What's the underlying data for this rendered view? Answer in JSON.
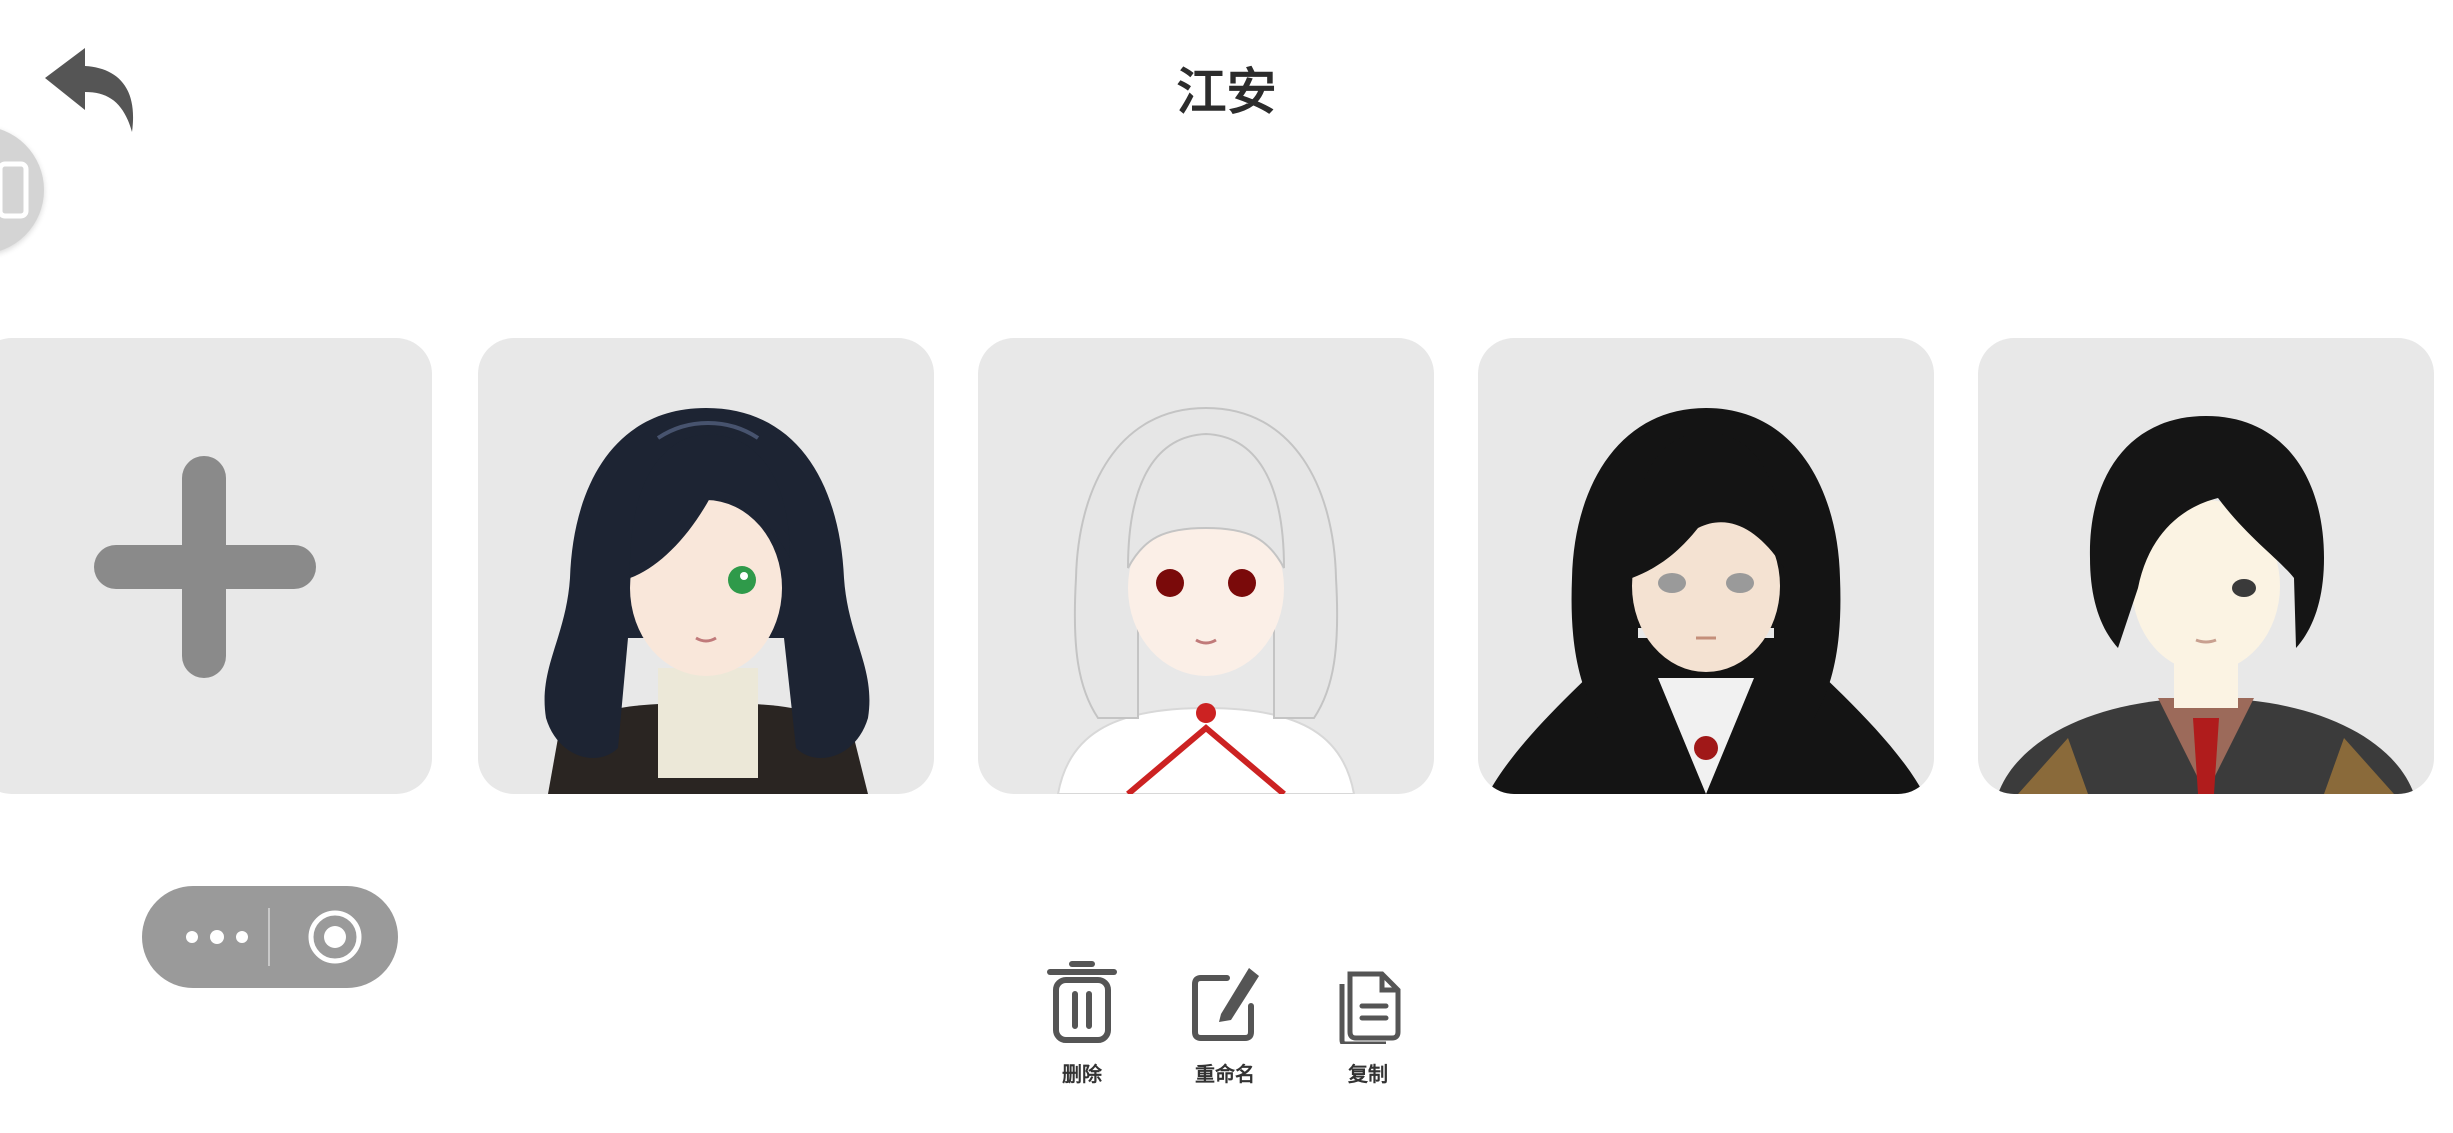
{
  "header": {
    "title": "江安",
    "back_icon": "back-arrow-icon"
  },
  "side_handle": {
    "icon": "phone-icon"
  },
  "cards": [
    {
      "type": "add",
      "icon": "plus-icon"
    },
    {
      "type": "avatar",
      "hair": "#1d2433",
      "skin": "#f9e7da",
      "eyes": "#2f9a4a",
      "outfit": "#2a2522"
    },
    {
      "type": "avatar",
      "hair": "#e6e6e6",
      "skin": "#fbefe7",
      "eyes": "#7a0a0a",
      "outfit": "#ffffff"
    },
    {
      "type": "avatar",
      "hair": "#141414",
      "skin": "#f4e2d2",
      "eyes": "#9a9a9a",
      "outfit": "#141414"
    },
    {
      "type": "avatar",
      "hair": "#151515",
      "skin": "#fbf3e3",
      "eyes": "#3a3a3a",
      "outfit": "#3b3b3b"
    }
  ],
  "capsule": {
    "more_icon": "more-dots-icon",
    "target_icon": "target-icon"
  },
  "actions": {
    "delete": {
      "label": "删除",
      "icon": "trash-icon"
    },
    "rename": {
      "label": "重命名",
      "icon": "edit-icon"
    },
    "copy": {
      "label": "复制",
      "icon": "copy-icon"
    }
  },
  "colors": {
    "card_bg": "#e8e8e8",
    "icon_gray": "#555555",
    "plus_gray": "#8a8a8a"
  }
}
